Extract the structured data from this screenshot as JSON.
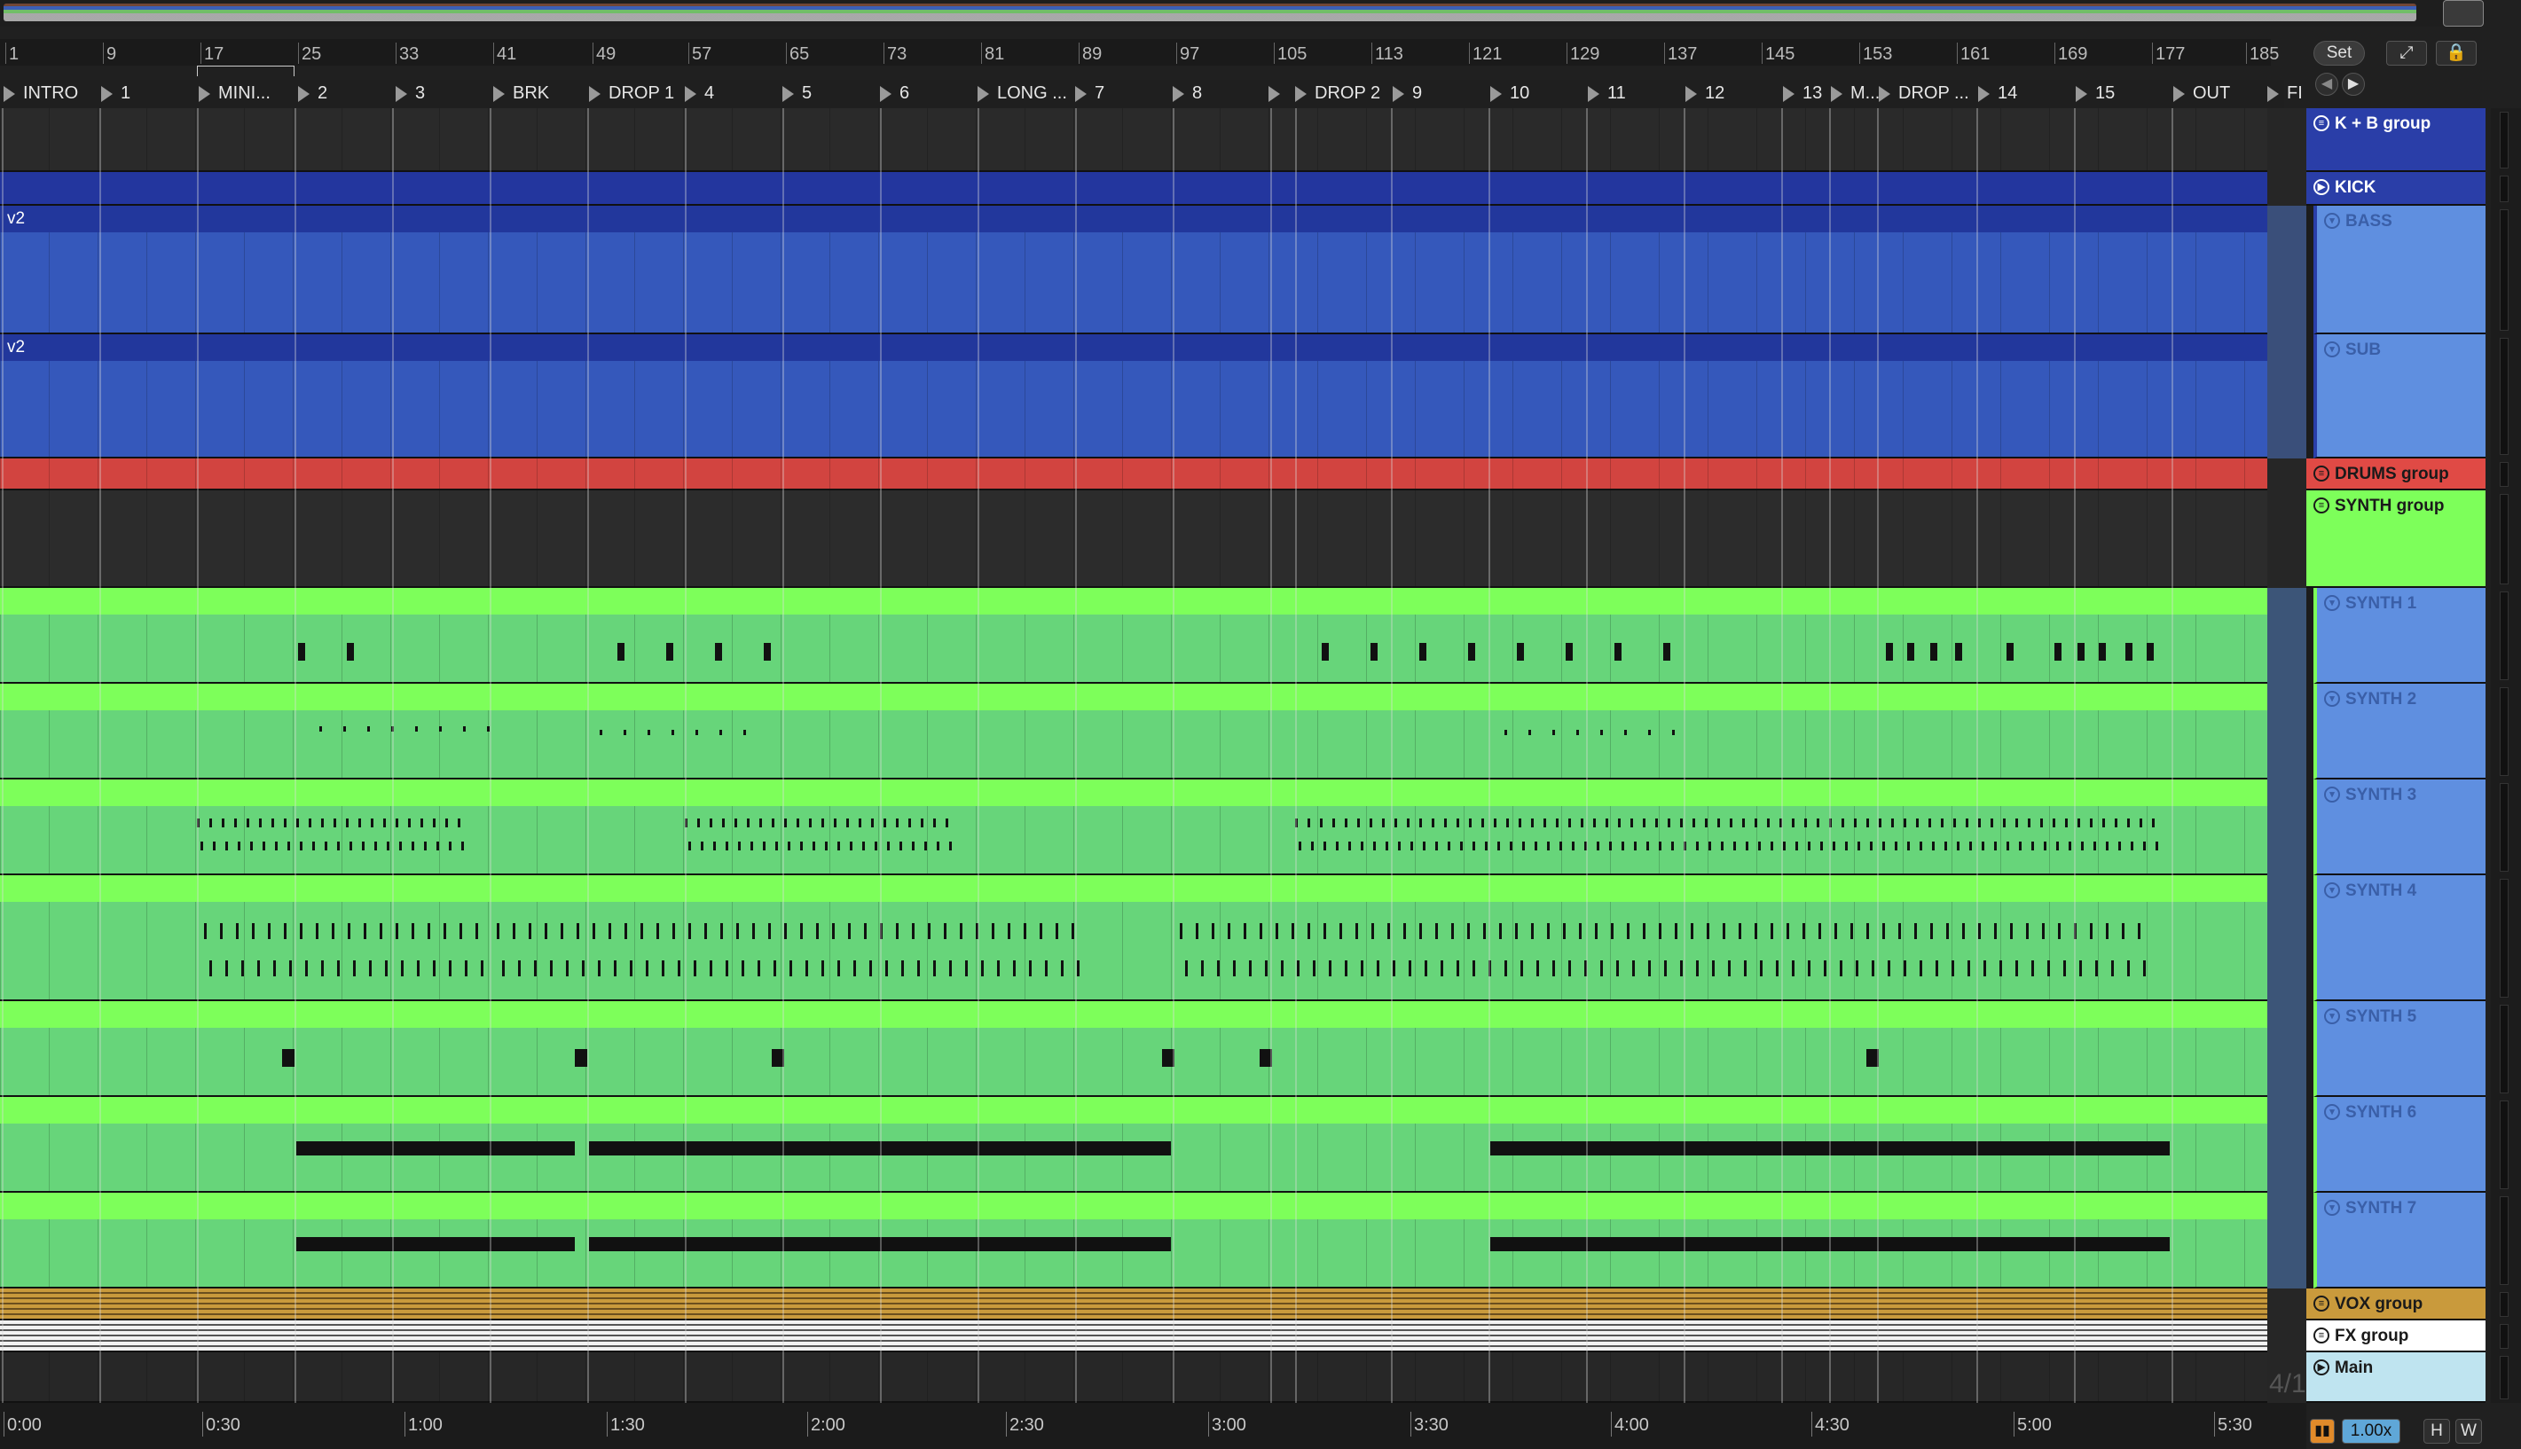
{
  "ruler": {
    "bars": [
      "1",
      "9",
      "17",
      "25",
      "33",
      "41",
      "49",
      "57",
      "65",
      "73",
      "81",
      "89",
      "97",
      "105",
      "113",
      "121",
      "129",
      "137",
      "145",
      "153",
      "161",
      "169",
      "177",
      "185"
    ]
  },
  "locators": [
    "INTRO",
    "1",
    "MINI...",
    "2",
    "3",
    "BRK",
    "DROP 1",
    "4",
    "5",
    "6",
    "LONG ...",
    "7",
    "8",
    "",
    "DROP 2",
    "9",
    "10",
    "11",
    "12",
    "13",
    "M...",
    "DROP ...",
    "14",
    "15",
    "OUT",
    "FI"
  ],
  "clips": {
    "bass_label": "v2",
    "sub_label": "v2"
  },
  "tracks": [
    {
      "name": "K + B group",
      "type": "group",
      "color": "#2a3ea8",
      "text": "#ffffff"
    },
    {
      "name": "KICK",
      "type": "audio",
      "color": "#2a3ea8",
      "text": "#ffffff"
    },
    {
      "name": "BASS",
      "type": "midi",
      "color": "#5f8fe0",
      "text": "#3a5fa8"
    },
    {
      "name": "SUB",
      "type": "midi",
      "color": "#5f8fe0",
      "text": "#3a5fa8"
    },
    {
      "name": "DRUMS group",
      "type": "group",
      "color": "#e04a45",
      "text": "#1a1a1a"
    },
    {
      "name": "SYNTH group",
      "type": "group",
      "color": "#7dff5a",
      "text": "#1a1a1a"
    },
    {
      "name": "SYNTH 1",
      "type": "midi",
      "color": "#5f8fe0",
      "text": "#3a5fa8"
    },
    {
      "name": "SYNTH 2",
      "type": "midi",
      "color": "#5f8fe0",
      "text": "#3a5fa8"
    },
    {
      "name": "SYNTH 3",
      "type": "midi",
      "color": "#5f8fe0",
      "text": "#3a5fa8"
    },
    {
      "name": "SYNTH 4",
      "type": "midi",
      "color": "#5f8fe0",
      "text": "#3a5fa8"
    },
    {
      "name": "SYNTH 5",
      "type": "midi",
      "color": "#5f8fe0",
      "text": "#3a5fa8"
    },
    {
      "name": "SYNTH 6",
      "type": "midi",
      "color": "#5f8fe0",
      "text": "#3a5fa8"
    },
    {
      "name": "SYNTH 7",
      "type": "midi",
      "color": "#5f8fe0",
      "text": "#3a5fa8"
    },
    {
      "name": "VOX group",
      "type": "group",
      "color": "#c99a3c",
      "text": "#1a1a1a"
    },
    {
      "name": "FX group",
      "type": "group",
      "color": "#ffffff",
      "text": "#1a1a1a"
    },
    {
      "name": "Main",
      "type": "main",
      "color": "#bfe4f0",
      "text": "#1a1a1a"
    }
  ],
  "timeline": [
    "0:00",
    "0:30",
    "1:00",
    "1:30",
    "2:00",
    "2:30",
    "3:00",
    "3:30",
    "4:00",
    "4:30",
    "5:00",
    "5:30"
  ],
  "controls": {
    "set_label": "Set",
    "zoom": "1.00x",
    "h_label": "H",
    "w_label": "W",
    "time_signature": "4/1"
  },
  "colors": {
    "kb_blue": "#2a3ea8",
    "clip_blue": "#3c5fc0",
    "drums_red": "#d24440",
    "synth_green": "#7dff5a",
    "clip_green": "#67d57a",
    "vox": "#c99a3c"
  }
}
